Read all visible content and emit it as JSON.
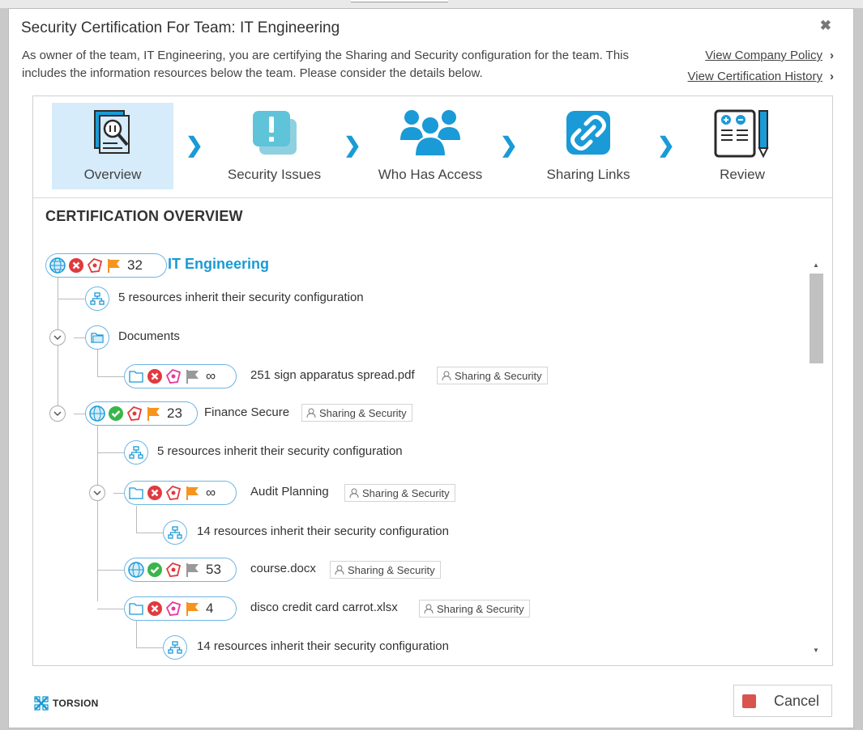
{
  "dialog": {
    "title": "Security Certification For Team: IT Engineering",
    "intro": "As owner of the team, IT Engineering, you are certifying the Sharing and Security configuration for the team. This includes the information resources below the team. Please consider the details below.",
    "links": {
      "company_policy": "View Company Policy",
      "certification_history": "View Certification History"
    }
  },
  "wizard": {
    "steps": [
      {
        "label": "Overview",
        "icon": "document-magnifier-icon",
        "active": true
      },
      {
        "label": "Security Issues",
        "icon": "alert-icon",
        "active": false
      },
      {
        "label": "Who Has Access",
        "icon": "people-icon",
        "active": false
      },
      {
        "label": "Sharing Links",
        "icon": "link-icon",
        "active": false
      },
      {
        "label": "Review",
        "icon": "checklist-pen-icon",
        "active": false
      }
    ]
  },
  "overview": {
    "title": "CERTIFICATION OVERVIEW",
    "sharing_label": "Sharing & Security",
    "rows": [
      {
        "kind": "team",
        "name": "IT Engineering",
        "count": "32"
      },
      {
        "kind": "inherit",
        "text": "5 resources inherit their security configuration"
      },
      {
        "kind": "folder",
        "name": "Documents"
      },
      {
        "kind": "item",
        "name": "251 sign apparatus spread.pdf",
        "count": "∞"
      },
      {
        "kind": "item",
        "name": "Finance Secure",
        "count": "23"
      },
      {
        "kind": "inherit",
        "text": "5 resources inherit their security configuration"
      },
      {
        "kind": "item",
        "name": "Audit Planning",
        "count": "∞"
      },
      {
        "kind": "inherit",
        "text": "14 resources inherit their security configuration"
      },
      {
        "kind": "item",
        "name": "course.docx",
        "count": "53"
      },
      {
        "kind": "item",
        "name": "disco credit card carrot.xlsx",
        "count": "4"
      },
      {
        "kind": "inherit",
        "text": "14 resources inherit their security configuration"
      }
    ]
  },
  "footer": {
    "brand": "TORSION",
    "cancel_label": "Cancel"
  },
  "colors": {
    "accent": "#1a9ad6",
    "active_step_bg": "#d6ecfa",
    "error_red": "#e03a3e",
    "ok_green": "#39b54a",
    "flag_orange": "#f7941d",
    "flag_grey": "#999999",
    "tag_pink": "#e6399b",
    "cancel_red": "#d9534f"
  }
}
